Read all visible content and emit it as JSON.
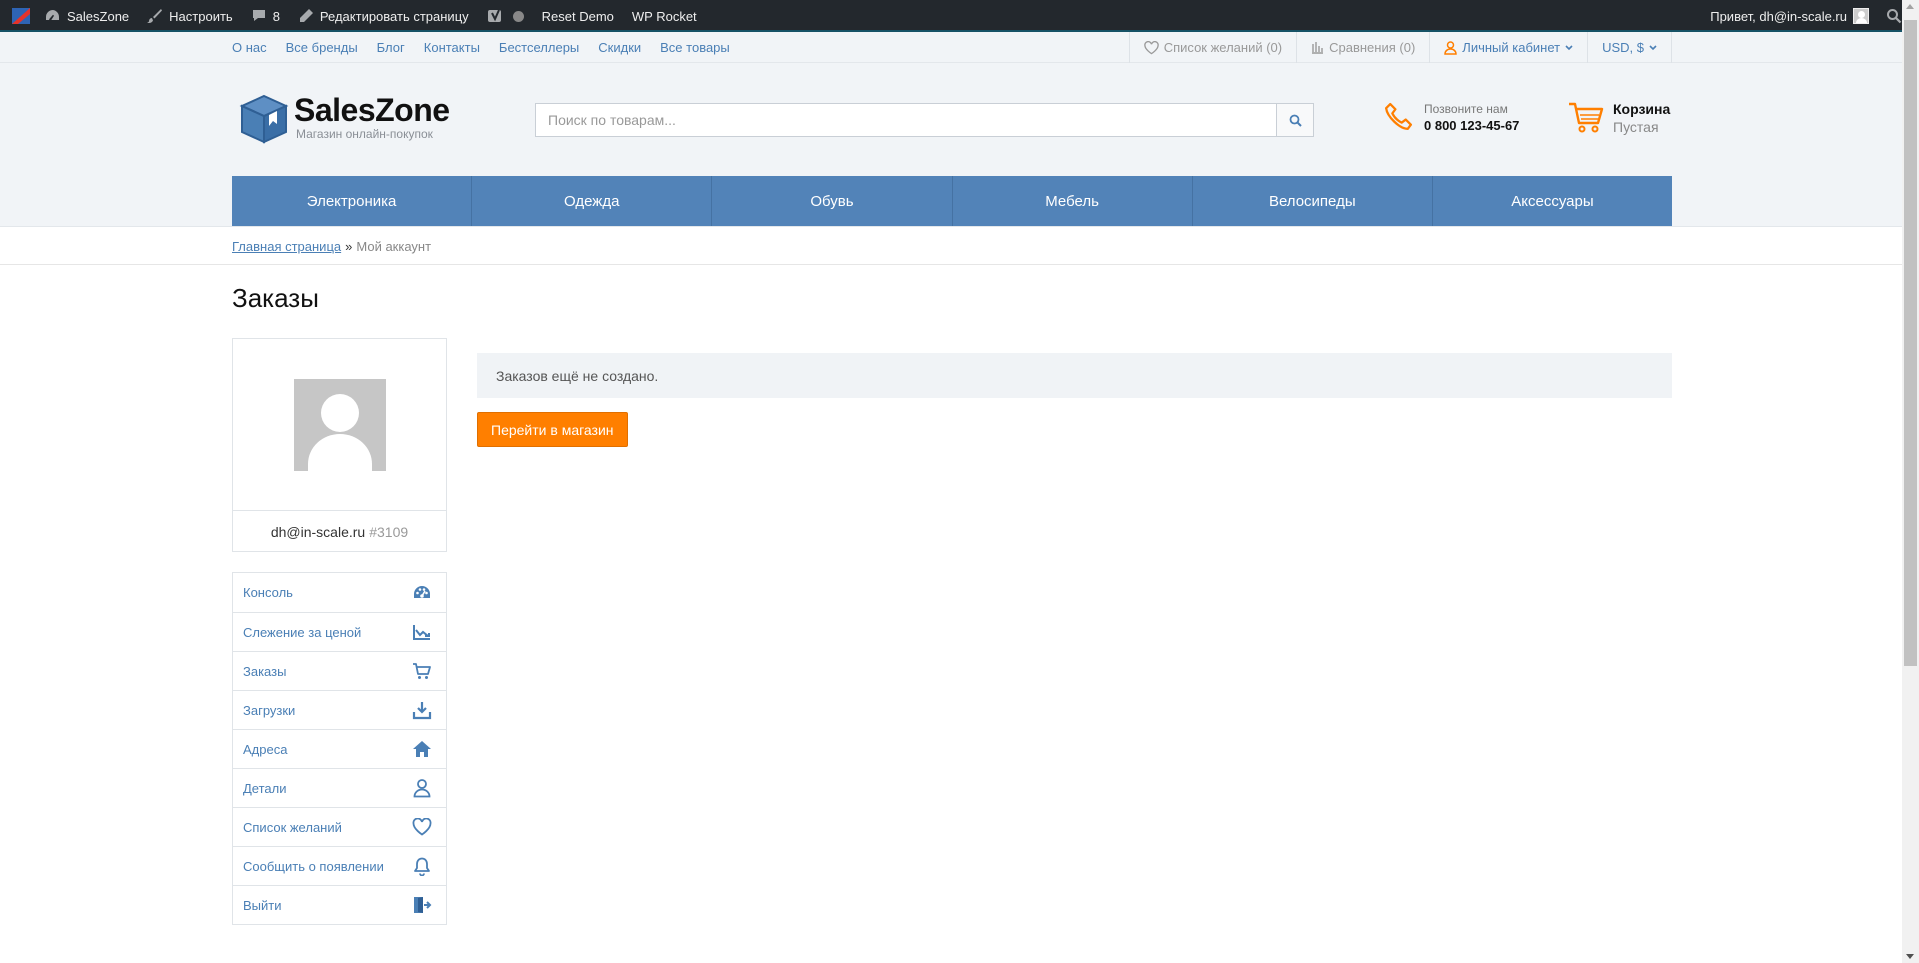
{
  "admin_bar": {
    "site_name": "SalesZone",
    "customize": "Настроить",
    "comments_count": "8",
    "edit_page": "Редактировать страницу",
    "reset_demo": "Reset Demo",
    "wp_rocket": "WP Rocket",
    "greeting": "Привет, dh@in-scale.ru"
  },
  "top_links": {
    "items": [
      "О нас",
      "Все бренды",
      "Блог",
      "Контакты",
      "Бестселлеры",
      "Скидки",
      "Все товары"
    ],
    "wishlist": "Список желаний (0)",
    "compare": "Сравнения (0)",
    "account": "Личный кабинет",
    "currency": "USD, $"
  },
  "header": {
    "logo_name": "SalesZone",
    "logo_tagline": "Магазин онлайн-покупок",
    "search_placeholder": "Поиск по товарам...",
    "phone_label": "Позвоните нам",
    "phone_number": "0 800 123-45-67",
    "cart_title": "Корзина",
    "cart_status": "Пустая"
  },
  "categories": [
    "Электроника",
    "Одежда",
    "Обувь",
    "Мебель",
    "Велосипеды",
    "Аксессуары"
  ],
  "breadcrumb": {
    "home": "Главная страница",
    "separator": "»",
    "current": "Мой аккаунт"
  },
  "page": {
    "title": "Заказы",
    "notice": "Заказов ещё не создано.",
    "shop_button": "Перейти в магазин"
  },
  "profile": {
    "email": "dh@in-scale.ru",
    "user_id": "#3109"
  },
  "account_menu": [
    {
      "label": "Консоль",
      "icon": "dashboard-icon"
    },
    {
      "label": "Слежение за ценой",
      "icon": "price-chart-icon"
    },
    {
      "label": "Заказы",
      "icon": "cart-icon"
    },
    {
      "label": "Загрузки",
      "icon": "download-icon"
    },
    {
      "label": "Адреса",
      "icon": "home-icon"
    },
    {
      "label": "Детали",
      "icon": "user-icon"
    },
    {
      "label": "Список желаний",
      "icon": "heart-icon"
    },
    {
      "label": "Сообщить о появлении",
      "icon": "bell-icon"
    },
    {
      "label": "Выйти",
      "icon": "logout-icon"
    }
  ],
  "colors": {
    "admin_bar_bg": "#23282d",
    "link_blue": "#4a7fb5",
    "nav_blue": "#5283b8",
    "accent_orange": "#ff7f00",
    "header_bg": "#f1f4f7"
  }
}
